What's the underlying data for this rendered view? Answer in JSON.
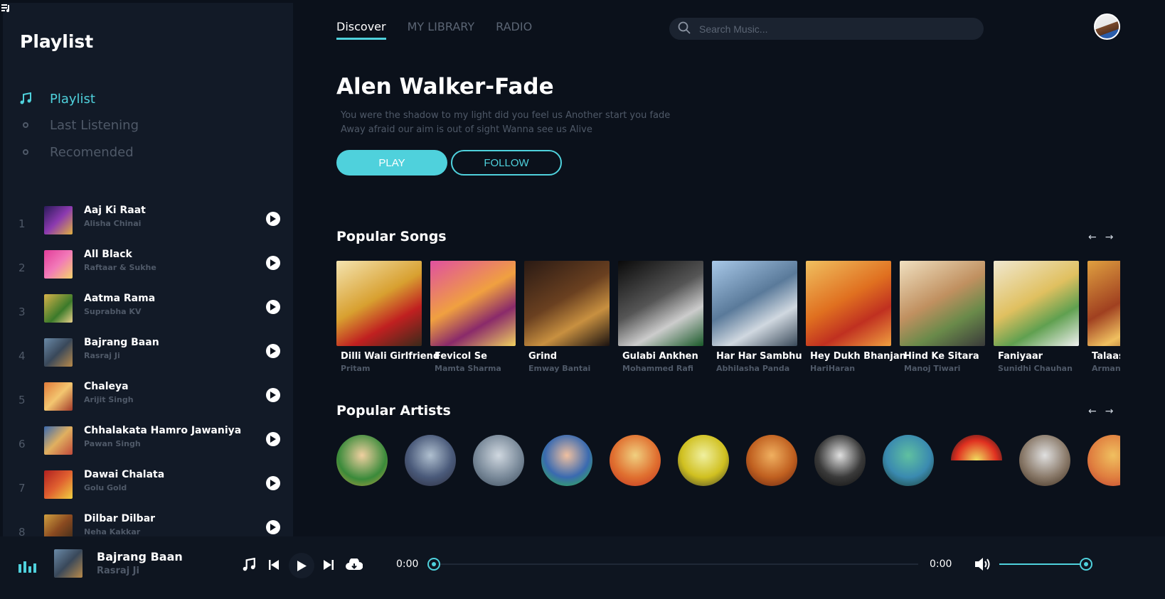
{
  "colors": {
    "accent": "#4fd1dc",
    "background": "#0b111b",
    "sidebar": "#121a27",
    "muted": "#4f5968"
  },
  "sidebar": {
    "title": "Playlist",
    "nav": [
      {
        "label": "Playlist",
        "icon": "music-note-icon",
        "active": true
      },
      {
        "label": "Last Listening",
        "icon": "circle-icon",
        "active": false
      },
      {
        "label": "Recomended",
        "icon": "circle-icon",
        "active": false
      }
    ],
    "tracks": [
      {
        "num": "1",
        "title": "Aaj Ki Raat",
        "artist": "Alisha Chinai"
      },
      {
        "num": "2",
        "title": "All Black",
        "artist": "Raftaar & Sukhe"
      },
      {
        "num": "3",
        "title": "Aatma Rama",
        "artist": "Suprabha KV"
      },
      {
        "num": "4",
        "title": "Bajrang Baan",
        "artist": "Rasraj Ji"
      },
      {
        "num": "5",
        "title": "Chaleya",
        "artist": "Arijit Singh"
      },
      {
        "num": "6",
        "title": "Chhalakata Hamro Jawaniya",
        "artist": "Pawan Singh"
      },
      {
        "num": "7",
        "title": "Dawai Chalata",
        "artist": "Golu Gold"
      },
      {
        "num": "8",
        "title": "Dilbar Dilbar",
        "artist": "Neha Kakkar"
      }
    ]
  },
  "header": {
    "tabs": [
      {
        "label": "Discover",
        "active": true
      },
      {
        "label": "MY LIBRARY",
        "active": false
      },
      {
        "label": "RADIO",
        "active": false
      }
    ],
    "search": {
      "placeholder": "Search Music..."
    }
  },
  "hero": {
    "title": "Alen Walker-Fade",
    "description_line1": "You were the shadow to my light did you feel us Another start you fade",
    "description_line2": "Away afraid our aim is out of sight Wanna see us Alive",
    "play_label": "PLAY",
    "follow_label": "FOLLOW"
  },
  "popular_songs": {
    "title": "Popular Songs",
    "items": [
      {
        "title": "Dilli Wali Girlfriend",
        "artist": "Pritam"
      },
      {
        "title": "Fevicol Se",
        "artist": "Mamta Sharma"
      },
      {
        "title": "Grind",
        "artist": "Emway Bantai"
      },
      {
        "title": "Gulabi Ankhen",
        "artist": "Mohammed Rafi"
      },
      {
        "title": "Har Har Sambhu",
        "artist": "Abhilasha Panda"
      },
      {
        "title": "Hey Dukh Bhanjan",
        "artist": "HariHaran"
      },
      {
        "title": "Hind Ke Sitara",
        "artist": "Manoj Tiwari"
      },
      {
        "title": "Faniyaar",
        "artist": "Sunidhi Chauhan"
      },
      {
        "title": "Talaash",
        "artist": "Arman"
      }
    ]
  },
  "popular_artists": {
    "title": "Popular Artists",
    "count": 12
  },
  "player": {
    "title": "Bajrang Baan",
    "artist": "Rasraj Ji",
    "current_time": "0:00",
    "total_time": "0:00",
    "progress": 0,
    "volume": 0.95
  }
}
